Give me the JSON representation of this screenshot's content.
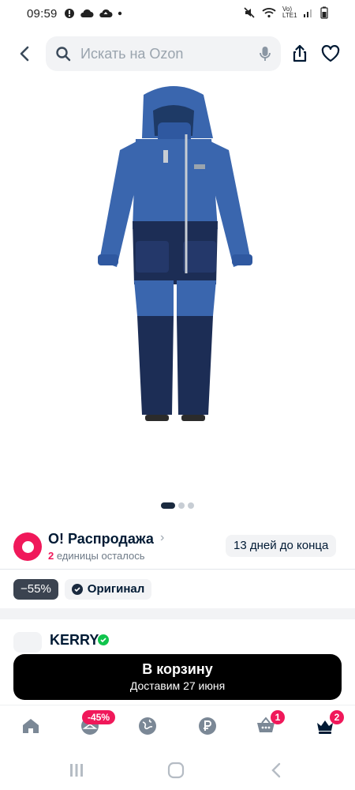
{
  "status_bar": {
    "time": "09:59",
    "network": "Vo) LTE1"
  },
  "search": {
    "placeholder": "Искать на Ozon"
  },
  "gallery": {
    "pages": 3,
    "active_index": 0
  },
  "sale": {
    "title": "O! Распродажа",
    "remaining_count": "2",
    "remaining_text": "единицы осталось",
    "days_left": "13 дней до конца"
  },
  "badges": {
    "discount": "−55%",
    "original": "Оригинал"
  },
  "brand": {
    "name": "KERRY"
  },
  "cart_button": {
    "label": "В корзину",
    "delivery": "Доставим 27 июня"
  },
  "bottom_nav": {
    "catalog_badge": "-45%",
    "cart_badge": "1",
    "profile_badge": "2"
  },
  "colors": {
    "accent_pink": "#f0185a",
    "dark": "#001a34",
    "verified_green": "#10c44c"
  }
}
